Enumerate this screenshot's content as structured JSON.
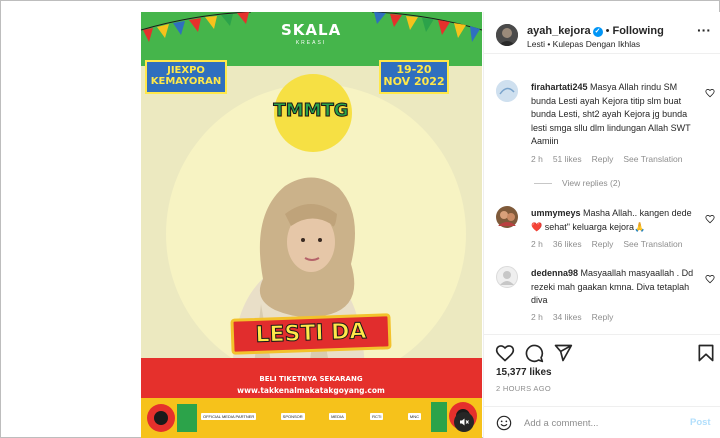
{
  "media": {
    "brand": "SKALA",
    "brand_sub": "KREASI",
    "location_line1": "JIEXPO",
    "location_line2": "KEMAYORAN",
    "date_line1": "19-20",
    "date_line2": "NOV 2022",
    "event_logo": "TMMTG",
    "performer": "LESTI DA",
    "ticket_line1": "BELI TIKETNYA SEKARANG",
    "ticket_line2": "www.takkenalmakatakgoyang.com",
    "sponsors": [
      "OFFICIAL MEDIA PARTNER",
      "SPONSOR",
      "MEDIA",
      "RCTI",
      "MNC"
    ]
  },
  "header": {
    "username": "ayah_kejora",
    "following": "Following",
    "subtitle": "Lesti • Kulepas Dengan Ikhlas"
  },
  "comments": [
    {
      "username": "firahartati245",
      "text": "Masya Allah rindu SM bunda Lesti ayah Kejora titip slm buat bunda Lesti, sht2 ayah Kejora jg bunda lesti smga sllu dlm lindungan Allah SWT Aamiin",
      "time": "2 h",
      "likes": "51 likes",
      "reply": "Reply",
      "translate": "See Translation",
      "view_replies": "View replies (2)"
    },
    {
      "username": "ummymeys",
      "text": "Masha Allah.. kangen dede❤️  sehat\" keluarga kejora🙏",
      "time": "2 h",
      "likes": "36 likes",
      "reply": "Reply",
      "translate": "See Translation"
    },
    {
      "username": "dedenna98",
      "text": "Masyaallah masyaallah . Dd rezeki mah gaakan kmna. Diva tetaplah diva",
      "time": "2 h",
      "likes": "34 likes",
      "reply": "Reply"
    }
  ],
  "likes_count": "15,377 likes",
  "time_ago": "2 HOURS AGO",
  "add_comment_placeholder": "Add a comment...",
  "post_label": "Post",
  "colors": {
    "link_blue": "#0095f6",
    "muted": "#8e8e8e",
    "post_disabled": "#b2dffc"
  }
}
